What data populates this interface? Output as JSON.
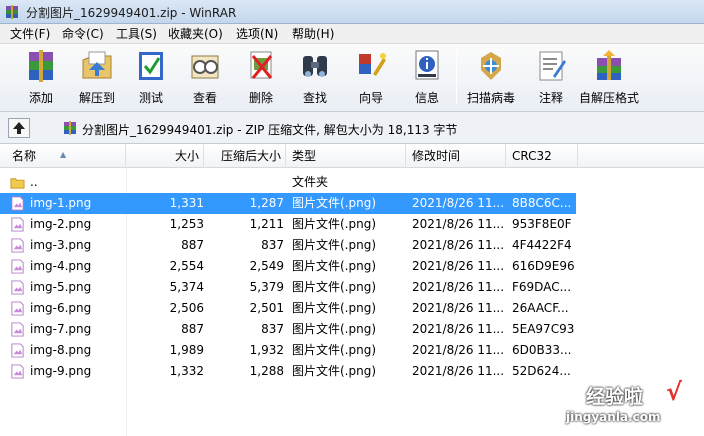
{
  "window": {
    "title": "分割图片_1629949401.zip - WinRAR"
  },
  "menu": [
    {
      "label": "文件(F)"
    },
    {
      "label": "命令(C)"
    },
    {
      "label": "工具(S)"
    },
    {
      "label": "收藏夹(O)"
    },
    {
      "label": "选项(N)"
    },
    {
      "label": "帮助(H)"
    }
  ],
  "toolbar": [
    {
      "label": "添加",
      "icon": "add-archive-icon"
    },
    {
      "label": "解压到",
      "icon": "extract-to-icon"
    },
    {
      "label": "测试",
      "icon": "test-icon"
    },
    {
      "label": "查看",
      "icon": "view-icon"
    },
    {
      "label": "删除",
      "icon": "delete-icon"
    },
    {
      "label": "查找",
      "icon": "find-icon"
    },
    {
      "label": "向导",
      "icon": "wizard-icon"
    },
    {
      "label": "信息",
      "icon": "info-icon"
    },
    {
      "label": "扫描病毒",
      "icon": "virus-scan-icon"
    },
    {
      "label": "注释",
      "icon": "comment-icon"
    },
    {
      "label": "自解压格式",
      "icon": "sfx-icon"
    }
  ],
  "address": {
    "text": "分割图片_1629949401.zip - ZIP 压缩文件, 解包大小为 18,113 字节"
  },
  "columns": {
    "name": "名称",
    "size": "大小",
    "packed": "压缩后大小",
    "type": "类型",
    "modified": "修改时间",
    "crc": "CRC32"
  },
  "files": [
    {
      "name": "..",
      "size": "",
      "packed": "",
      "type": "文件夹",
      "modified": "",
      "crc": "",
      "kind": "folder"
    },
    {
      "name": "img-1.png",
      "size": "1,331",
      "packed": "1,287",
      "type": "图片文件(.png)",
      "modified": "2021/8/26 11...",
      "crc": "8B8C6C...",
      "kind": "image",
      "selected": true
    },
    {
      "name": "img-2.png",
      "size": "1,253",
      "packed": "1,211",
      "type": "图片文件(.png)",
      "modified": "2021/8/26 11...",
      "crc": "953F8E0F",
      "kind": "image"
    },
    {
      "name": "img-3.png",
      "size": "887",
      "packed": "837",
      "type": "图片文件(.png)",
      "modified": "2021/8/26 11...",
      "crc": "4F4422F4",
      "kind": "image"
    },
    {
      "name": "img-4.png",
      "size": "2,554",
      "packed": "2,549",
      "type": "图片文件(.png)",
      "modified": "2021/8/26 11...",
      "crc": "616D9E96",
      "kind": "image"
    },
    {
      "name": "img-5.png",
      "size": "5,374",
      "packed": "5,379",
      "type": "图片文件(.png)",
      "modified": "2021/8/26 11...",
      "crc": "F69DAC...",
      "kind": "image"
    },
    {
      "name": "img-6.png",
      "size": "2,506",
      "packed": "2,501",
      "type": "图片文件(.png)",
      "modified": "2021/8/26 11...",
      "crc": "26AACF...",
      "kind": "image"
    },
    {
      "name": "img-7.png",
      "size": "887",
      "packed": "837",
      "type": "图片文件(.png)",
      "modified": "2021/8/26 11...",
      "crc": "5EA97C93",
      "kind": "image"
    },
    {
      "name": "img-8.png",
      "size": "1,989",
      "packed": "1,932",
      "type": "图片文件(.png)",
      "modified": "2021/8/26 11...",
      "crc": "6D0B33...",
      "kind": "image"
    },
    {
      "name": "img-9.png",
      "size": "1,332",
      "packed": "1,288",
      "type": "图片文件(.png)",
      "modified": "2021/8/26 11...",
      "crc": "52D624...",
      "kind": "image"
    }
  ],
  "watermark": {
    "main": "经验啦",
    "check": "√",
    "sub": "jingyanla.com"
  },
  "colors": {
    "selection": "#3399ff"
  }
}
